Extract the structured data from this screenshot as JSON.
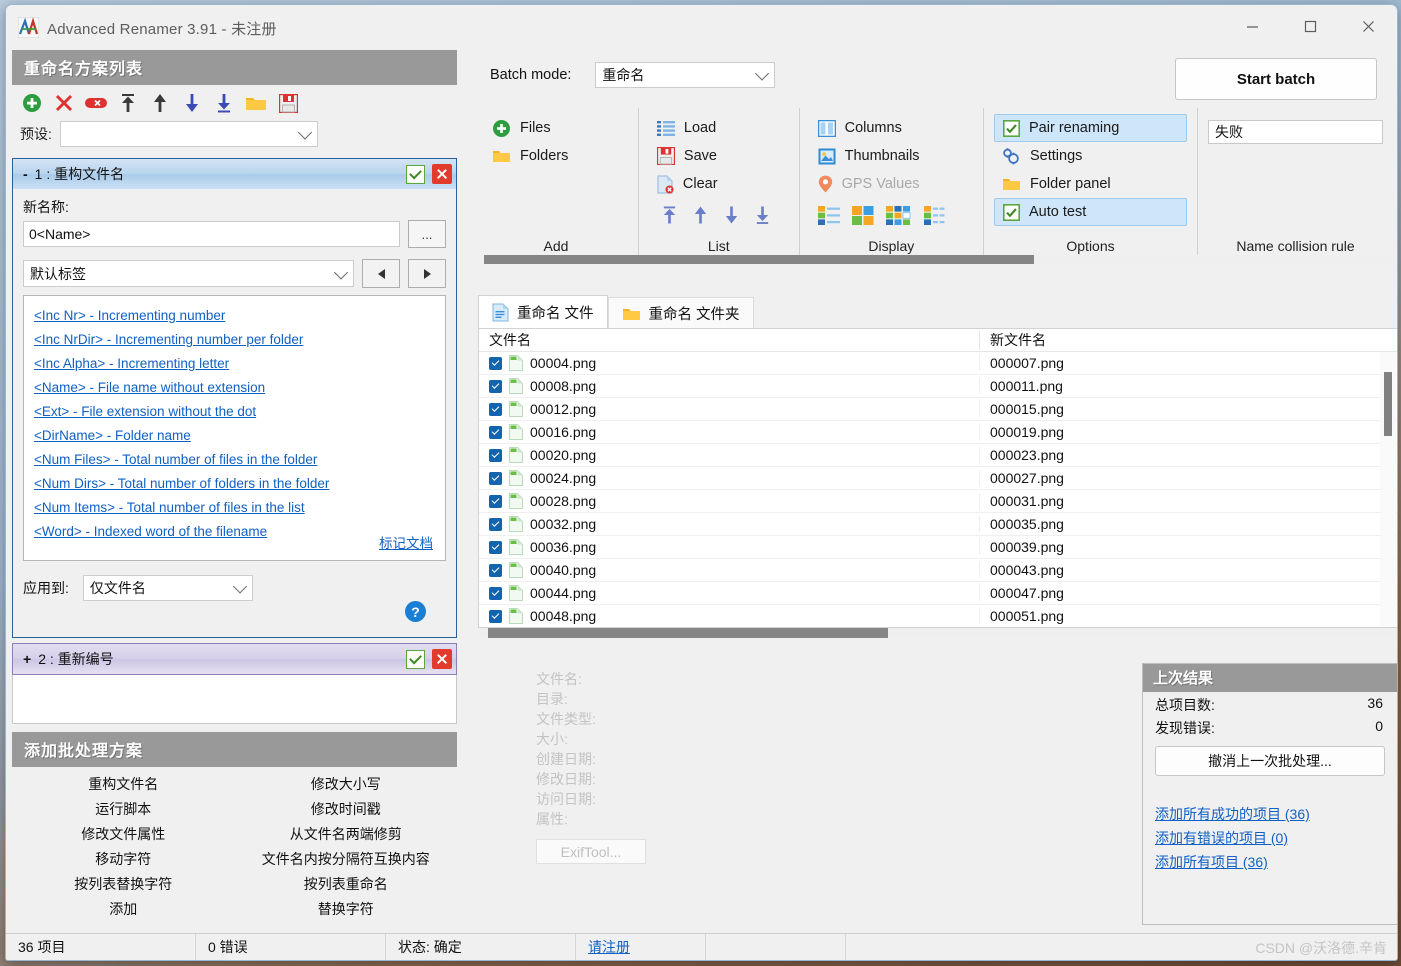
{
  "window": {
    "title": "Advanced Renamer 3.91 - 未注册",
    "icon": "app-icon",
    "minimize": "—",
    "maximize": "□",
    "close": "✕"
  },
  "left_panel": {
    "header": "重命名方案列表",
    "toolbar_icons": [
      "add-method-icon",
      "remove-method-icon",
      "clear-methods-icon",
      "move-top-icon",
      "move-up-icon",
      "move-down-icon",
      "move-bottom-icon",
      "open-folder-icon",
      "save-icon"
    ],
    "preset_label": "预设:",
    "preset_value": "",
    "method1": {
      "collapse": "-",
      "title": "1 : 重构文件名",
      "newname_label": "新名称:",
      "newname_value": "0<Name>",
      "browse_label": "...",
      "tag_combo_value": "默认标签",
      "tags": [
        "<Inc Nr> - Incrementing number",
        "<Inc NrDir> - Incrementing number per folder",
        "<Inc Alpha> - Incrementing letter",
        "<Name> - File name without extension",
        "<Ext> - File extension without the dot",
        "<DirName> - Folder name",
        "<Num Files> - Total number of files in the folder",
        "<Num Dirs> - Total number of folders in the folder",
        "<Num Items> - Total number of files in the list",
        "<Word> - Indexed word of the filename"
      ],
      "doc_link": "标记文档",
      "apply_label": "应用到:",
      "apply_value": "仅文件名",
      "help": "?"
    },
    "method2": {
      "collapse": "+",
      "title": "2 : 重新编号"
    },
    "add_methods": {
      "header": "添加批处理方案",
      "items": [
        "重构文件名",
        "修改大小写",
        "运行脚本",
        "修改时间戳",
        "修改文件属性",
        "从文件名两端修剪",
        "移动字符",
        "文件名内按分隔符互换内容",
        "按列表替换字符",
        "按列表重命名",
        "添加",
        "替换字符"
      ]
    }
  },
  "ribbon": {
    "batch_mode_label": "Batch mode:",
    "batch_mode_value": "重命名",
    "start_batch": "Start batch",
    "groups": [
      {
        "caption": "Add",
        "items": [
          {
            "label": "Files",
            "icon": "add-files-icon",
            "state": "normal"
          },
          {
            "label": "Folders",
            "icon": "add-folders-icon",
            "state": "normal"
          }
        ]
      },
      {
        "caption": "List",
        "items": [
          {
            "label": "Load",
            "icon": "load-list-icon",
            "state": "normal"
          },
          {
            "label": "Save",
            "icon": "save-list-icon",
            "state": "normal"
          },
          {
            "label": "Clear",
            "icon": "clear-list-icon",
            "state": "normal"
          }
        ],
        "arrows": [
          "move-top-icon",
          "move-up-icon",
          "move-down-icon",
          "move-bottom-icon"
        ]
      },
      {
        "caption": "Display",
        "items": [
          {
            "label": "Columns",
            "icon": "columns-icon",
            "state": "normal"
          },
          {
            "label": "Thumbnails",
            "icon": "thumbnails-icon",
            "state": "normal"
          },
          {
            "label": "GPS Values",
            "icon": "gps-pin-icon",
            "state": "disabled"
          }
        ],
        "view_icons": [
          "view-list-icon",
          "view-tiles-icon",
          "view-grid-icon",
          "view-details-icon"
        ]
      },
      {
        "caption": "Options",
        "items": [
          {
            "label": "Pair renaming",
            "icon": "checkbox-checked-icon",
            "state": "selected"
          },
          {
            "label": "Settings",
            "icon": "settings-gear-icon",
            "state": "normal"
          },
          {
            "label": "Folder panel",
            "icon": "folder-icon",
            "state": "normal"
          },
          {
            "label": "Auto test",
            "icon": "checkbox-checked-icon",
            "state": "selected"
          }
        ]
      },
      {
        "caption": "Name collision rule",
        "collision_value": "失败"
      }
    ]
  },
  "tabs": [
    {
      "label": "重命名 文件",
      "icon": "file-doc-icon",
      "active": true
    },
    {
      "label": "重命名 文件夹",
      "icon": "folder-icon",
      "active": false
    }
  ],
  "file_list": {
    "columns": [
      "文件名",
      "新文件名"
    ],
    "rows": [
      {
        "checked": true,
        "name": "00004.png",
        "newname": "000007.png"
      },
      {
        "checked": true,
        "name": "00008.png",
        "newname": "000011.png"
      },
      {
        "checked": true,
        "name": "00012.png",
        "newname": "000015.png"
      },
      {
        "checked": true,
        "name": "00016.png",
        "newname": "000019.png"
      },
      {
        "checked": true,
        "name": "00020.png",
        "newname": "000023.png"
      },
      {
        "checked": true,
        "name": "00024.png",
        "newname": "000027.png"
      },
      {
        "checked": true,
        "name": "00028.png",
        "newname": "000031.png"
      },
      {
        "checked": true,
        "name": "00032.png",
        "newname": "000035.png"
      },
      {
        "checked": true,
        "name": "00036.png",
        "newname": "000039.png"
      },
      {
        "checked": true,
        "name": "00040.png",
        "newname": "000043.png"
      },
      {
        "checked": true,
        "name": "00044.png",
        "newname": "000047.png"
      },
      {
        "checked": true,
        "name": "00048.png",
        "newname": "000051.png"
      }
    ]
  },
  "file_info": {
    "labels": [
      "文件名:",
      "目录:",
      "文件类型:",
      "大小:",
      "创建日期:",
      "修改日期:",
      "访问日期:",
      "属性:"
    ],
    "exif_button": "ExifTool..."
  },
  "last_result": {
    "header": "上次结果",
    "total_label": "总项目数:",
    "total_value": "36",
    "errors_label": "发现错误:",
    "errors_value": "0",
    "undo_button": "撤消上一次批处理...",
    "links": [
      "添加所有成功的项目 (36)",
      "添加有错误的项目 (0)",
      "添加所有项目 (36)"
    ]
  },
  "status_bar": {
    "items_count": "36 项目",
    "errors_count": "0 错误",
    "status": "状态: 确定",
    "register_link": "请注册",
    "watermark": "CSDN @沃洛德.辛肯"
  },
  "colors": {
    "accent_blue": "#1160c4",
    "header_gray": "#999999",
    "selection_blue": "#cde6fa",
    "checkbox_blue": "#1464ad"
  }
}
